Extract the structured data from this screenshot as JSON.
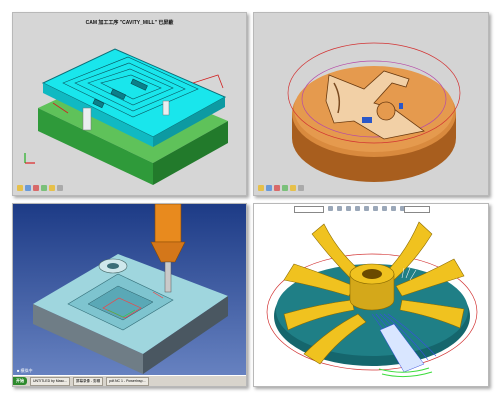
{
  "panels": {
    "top_left": {
      "title": "CAM 加工工序 \"CAVITY_MILL\" 已屏蔽"
    },
    "top_right": {},
    "bottom_left": {
      "status_text": "■ 模拟中",
      "taskbar": {
        "start_label": "开始",
        "buttons": [
          "UNTITLED by Masc...",
          "屏幕录像 - 剪辑",
          "pdf.NC 1 - PowerInsp..."
        ]
      }
    },
    "bottom_right": {}
  },
  "colors": {
    "toolpath_cyan": "#19e6ec",
    "part_green": "#2f9a3a",
    "copper": "#d98a3e",
    "impeller_teal": "#1f7f86",
    "impeller_yellow": "#f0c21f",
    "viewport_blue": "#2a4d9c"
  },
  "icons": [
    "toolbar-icons",
    "menu-icons",
    "cutter-tool-icon"
  ]
}
